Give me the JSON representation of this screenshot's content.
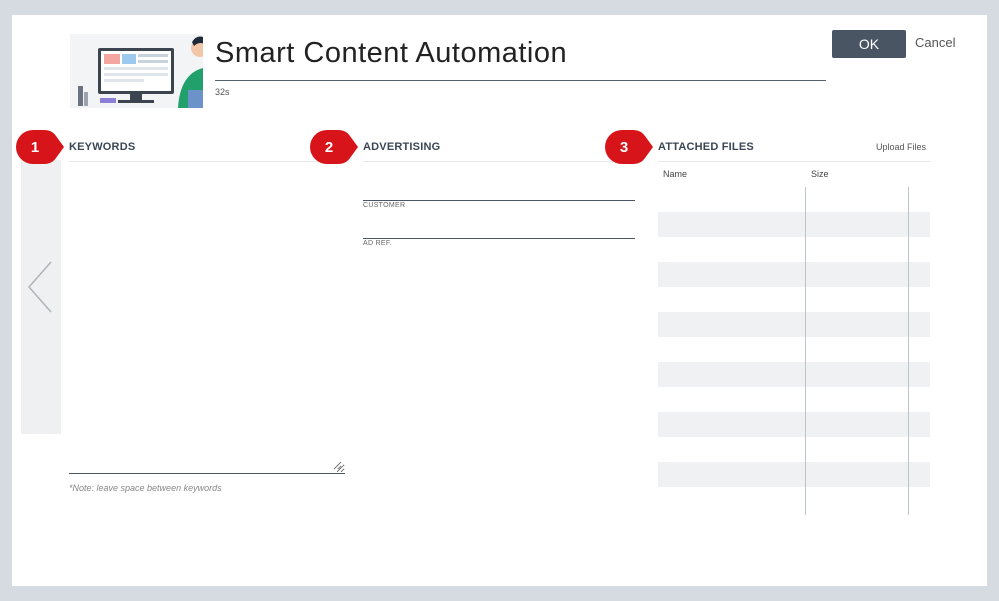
{
  "dialog": {
    "title": "Smart Content Automation",
    "duration": "32s",
    "ok_label": "OK",
    "cancel_label": "Cancel"
  },
  "sections": [
    {
      "number": "1",
      "title": "KEYWORDS"
    },
    {
      "number": "2",
      "title": "ADVERTISING"
    },
    {
      "number": "3",
      "title": "ATTACHED FILES"
    }
  ],
  "keywords": {
    "value": "",
    "note": "*Note: leave space between keywords"
  },
  "advertising": {
    "customer_label": "CUSTOMER",
    "customer_value": "",
    "ad_ref_label": "AD REF.",
    "ad_ref_value": ""
  },
  "files": {
    "upload_label": "Upload Files",
    "columns": [
      "Name",
      "Size"
    ],
    "rows": []
  },
  "colors": {
    "badge": "#d7141a",
    "ok_button": "#4a5563"
  },
  "icons": {
    "nav": "chevron-left-icon",
    "resize": "resize-grip-icon"
  }
}
